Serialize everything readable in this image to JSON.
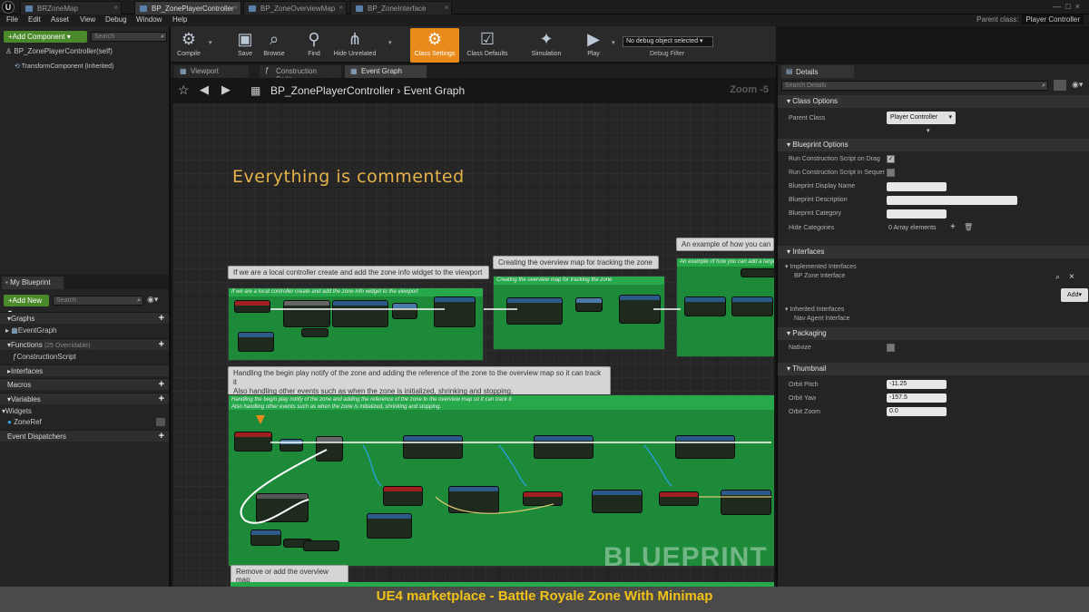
{
  "tabs": [
    {
      "label": "BRZoneMap"
    },
    {
      "label": "BP_ZonePlayerController"
    },
    {
      "label": "BP_ZoneOverviewMap"
    },
    {
      "label": "BP_ZoneInterface"
    }
  ],
  "parent": {
    "label": "Parent class:",
    "value": "Player Controller"
  },
  "menu": [
    "File",
    "Edit",
    "Asset",
    "View",
    "Debug",
    "Window",
    "Help"
  ],
  "components": {
    "add_label": "+Add Component ▾",
    "search_placeholder": "Search",
    "root": "BP_ZonePlayerController(self)",
    "child": "TransformComponent (Inherited)"
  },
  "my_blueprint": {
    "title": "My Blueprint",
    "add_label": "+Add New ▾",
    "search_placeholder": "Search",
    "sections": {
      "graphs": "Graphs",
      "graph_item": "EventGraph",
      "functions": "Functions",
      "functions_count": "(25 Overridable)",
      "function_item": "ConstructionScript",
      "interfaces": "Interfaces",
      "macros": "Macros",
      "variables": "Variables",
      "widgets": "Widgets",
      "zone_ref": "ZoneRef",
      "dispatchers": "Event Dispatchers"
    }
  },
  "toolbar": {
    "compile": "Compile",
    "save": "Save",
    "browse": "Browse",
    "find": "Find",
    "hide": "Hide Unrelated",
    "class_settings": "Class Settings",
    "class_defaults": "Class Defaults",
    "simulation": "Simulation",
    "play": "Play",
    "debug_object": "No debug object selected ▾",
    "debug_filter": "Debug Filter"
  },
  "editor_tabs": [
    "Viewport",
    "Construction Scrip",
    "Event Graph"
  ],
  "graph": {
    "breadcrumb_root": "BP_ZonePlayerController",
    "breadcrumb_sep": "›",
    "breadcrumb_leaf": "Event Graph",
    "zoom": "Zoom -5",
    "big_comment": "Everything is commented",
    "c1_bubble": "If we are a local controller create and add the zone info widget to the viewport",
    "c1_header": "If we are a local controller create and add the zone info widget to the viewport",
    "c2_bubble": "Creating the overview map for tracking the zone",
    "c2_header": "Creating the overview map for tracking the zone",
    "c3_bubble": "An example of how you can",
    "c3_header": "An example of how you can add a target",
    "c4_bubble_line1": "Handling the begin play notify of the zone and adding the reference of the zone to the overview map so it can track it",
    "c4_bubble_line2": "Also handling other events such as when the zone is initialized, shrinking and stopping.",
    "c4_header_line1": "Handling the begin play notify of the zone and adding the reference of the zone to the overview map so it can track it",
    "c4_header_line2": "Also handling other events such as when the zone is initialized, shrinking and stopping.",
    "c5_bubble": "Remove or add the overview map",
    "watermark": "BLUEPRINT"
  },
  "details": {
    "title": "Details",
    "search_placeholder": "Search Details",
    "class_options": "Class Options",
    "parent_class_label": "Parent Class",
    "parent_class_value": "Player Controller",
    "blueprint_options": "Blueprint Options",
    "run_cs_drag": "Run Construction Script on Drag",
    "run_cs_seq": "Run Construction Script in Sequer",
    "display_name": "Blueprint Display Name",
    "description": "Blueprint Description",
    "category": "Blueprint Category",
    "hide_categories": "Hide Categories",
    "array_elements": "0 Array elements",
    "interfaces": "Interfaces",
    "implemented": "Implemented Interfaces",
    "bp_zone_interface": "BP Zone Interface",
    "add": "Add▾",
    "inherited": "Inherited Interfaces",
    "nav_agent": "Nav Agent Interface",
    "packaging": "Packaging",
    "nativize": "Nativize",
    "thumbnail": "Thumbnail",
    "orbit_pitch": "Orbit Pitch",
    "orbit_pitch_val": "-11.25",
    "orbit_yaw": "Orbit Yaw",
    "orbit_yaw_val": "-157.5",
    "orbit_zoom": "Orbit Zoom",
    "orbit_zoom_val": "0.0"
  },
  "caption": "UE4 marketplace - Battle Royale Zone With Minimap",
  "colors": {
    "accent": "#e88b1c",
    "comment_green": "#1d8a3a",
    "caption": "#f2c218"
  }
}
